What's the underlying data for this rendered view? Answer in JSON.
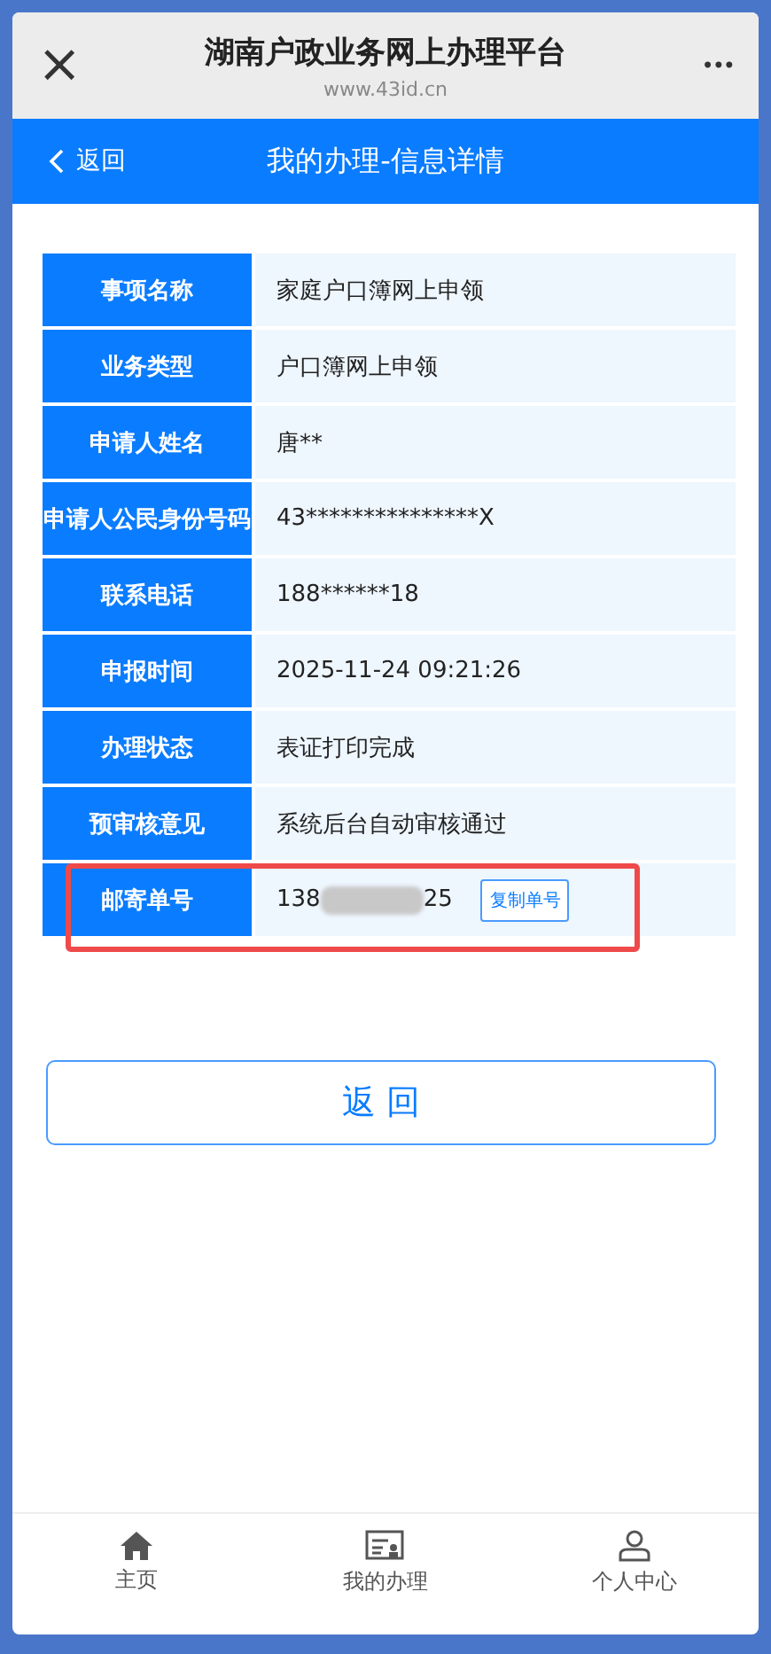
{
  "browser": {
    "close": "×",
    "title": "湖南户政业务网上办理平台",
    "url": "www.43id.cn",
    "more": "•••"
  },
  "nav": {
    "back": "返回",
    "title": "我的办理-信息详情"
  },
  "rows": [
    {
      "label": "事项名称",
      "value": "家庭户口簿网上申领",
      "highlighted": false
    },
    {
      "label": "业务类型",
      "value": "户口簿网上申领",
      "highlighted": false
    },
    {
      "label": "申请人姓名",
      "value": "唐**",
      "highlighted": false
    },
    {
      "label": "申请人公民身份号码",
      "value": "43***************X",
      "highlighted": false
    },
    {
      "label": "联系电话",
      "value": "188******18",
      "highlighted": false
    },
    {
      "label": "申报时间",
      "value": "2025-11-24 09:21:26",
      "highlighted": false
    },
    {
      "label": "办理状态",
      "value": "表证打印完成",
      "highlighted": false
    },
    {
      "label": "预审核意见",
      "value": "系统后台自动审核通过",
      "highlighted": false
    },
    {
      "label": "邮寄单号",
      "value": "138",
      "redacted": true,
      "value_end": "25",
      "action": "复制单号",
      "highlighted": true
    }
  ],
  "back_button": "返 回",
  "tabbar": [
    {
      "kind": "home",
      "label": "主页"
    },
    {
      "kind": "tasks",
      "label": "我的办理"
    },
    {
      "kind": "user",
      "label": "个人中心"
    }
  ]
}
